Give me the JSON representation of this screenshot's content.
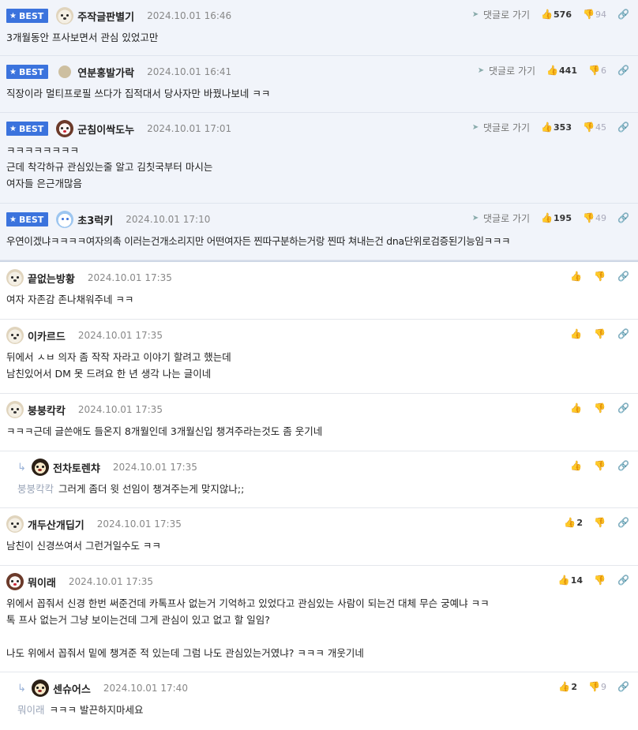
{
  "labels": {
    "best": "BEST",
    "goto_reply": "댓글로 가기"
  },
  "icons": {
    "star": "star-icon",
    "goto": "send-arrow-icon",
    "up": "thumbs-up-icon",
    "down": "thumbs-down-icon",
    "share": "link-icon",
    "reply": "reply-arrow-icon"
  },
  "colors": {
    "best_badge": "#3b73dd",
    "best_bg": "#f1f4fa",
    "mention": "#9aa5b8"
  },
  "best_comments": [
    {
      "name": "주작글판별기",
      "date": "2024.10.01 16:46",
      "text": "3개월동안 프사보면서 관심 있었고만",
      "up": "576",
      "down": "94"
    },
    {
      "name": "연분홍발가락",
      "date": "2024.10.01 16:41",
      "text": "직장이라 멀티프로필 쓰다가 집적대서 당사자만 바꿨나보네 ㅋㅋ",
      "up": "441",
      "down": "6"
    },
    {
      "name": "군침이싹도누",
      "date": "2024.10.01 17:01",
      "text": "ㅋㅋㅋㅋㅋㅋㅋㅋ\n근데 착각하규 관심있는줄 알고 김칫국부터 마시는\n여자들 은근개많음",
      "up": "353",
      "down": "45"
    },
    {
      "name": "초3럭키",
      "date": "2024.10.01 17:10",
      "text": "우연이겠냐ㅋㅋㅋㅋ여자의촉 이러는건개소리지만 어떤여자든 찐따구분하는거랑 찐따 쳐내는건 dna단위로검증된기능임ㅋㅋㅋ",
      "up": "195",
      "down": "49"
    }
  ],
  "comments": [
    {
      "name": "끝없는방황",
      "date": "2024.10.01 17:35",
      "text": "여자 자존감 존나채워주네 ㅋㅋ",
      "up": "",
      "down": ""
    },
    {
      "name": "이카르드",
      "date": "2024.10.01 17:35",
      "text": "뒤에서 ㅅㅂ 의자 좀 작작 자라고 이야기 할려고 했는데\n남친있어서 DM 못 드려요 한 년 생각 나는 글이네",
      "up": "",
      "down": ""
    },
    {
      "name": "붕붕칵칵",
      "date": "2024.10.01 17:35",
      "text": "ㅋㅋㅋ근데 글쓴애도 들온지 8개월인데 3개월신입 챙겨주라는것도 좀 웃기네",
      "up": "",
      "down": ""
    },
    {
      "name": "전차토렌챠",
      "date": "2024.10.01 17:35",
      "mention": "붕붕칵칵",
      "text": "그러게 좀더 윗 선임이 챙겨주는게 맞지않나;;",
      "up": "",
      "down": ""
    },
    {
      "name": "개두산개딥기",
      "date": "2024.10.01 17:35",
      "text": "남친이 신경쓰여서 그런거일수도 ㅋㅋ",
      "up": "2",
      "down": ""
    },
    {
      "name": "뭐이래",
      "date": "2024.10.01 17:35",
      "text": "위에서 꼽줘서 신경 한번 써준건데 카톡프사 없는거 기억하고 있었다고 관심있는 사람이 되는건 대체 무슨 궁예냐 ㅋㅋ\n톡 프사 없는거 그냥 보이는건데 그게 관심이 있고 없고 할 일임?\n\n나도 위에서 꼽줘서 밑에 챙겨준 적 있는데 그럼 나도 관심있는거였냐? ㅋㅋㅋ 개웃기네",
      "up": "14",
      "down": ""
    },
    {
      "name": "센슈어스",
      "date": "2024.10.01 17:40",
      "mention": "뭐이래",
      "text": "ㅋㅋㅋ 발끈하지마세요",
      "up": "2",
      "down": "9"
    }
  ]
}
